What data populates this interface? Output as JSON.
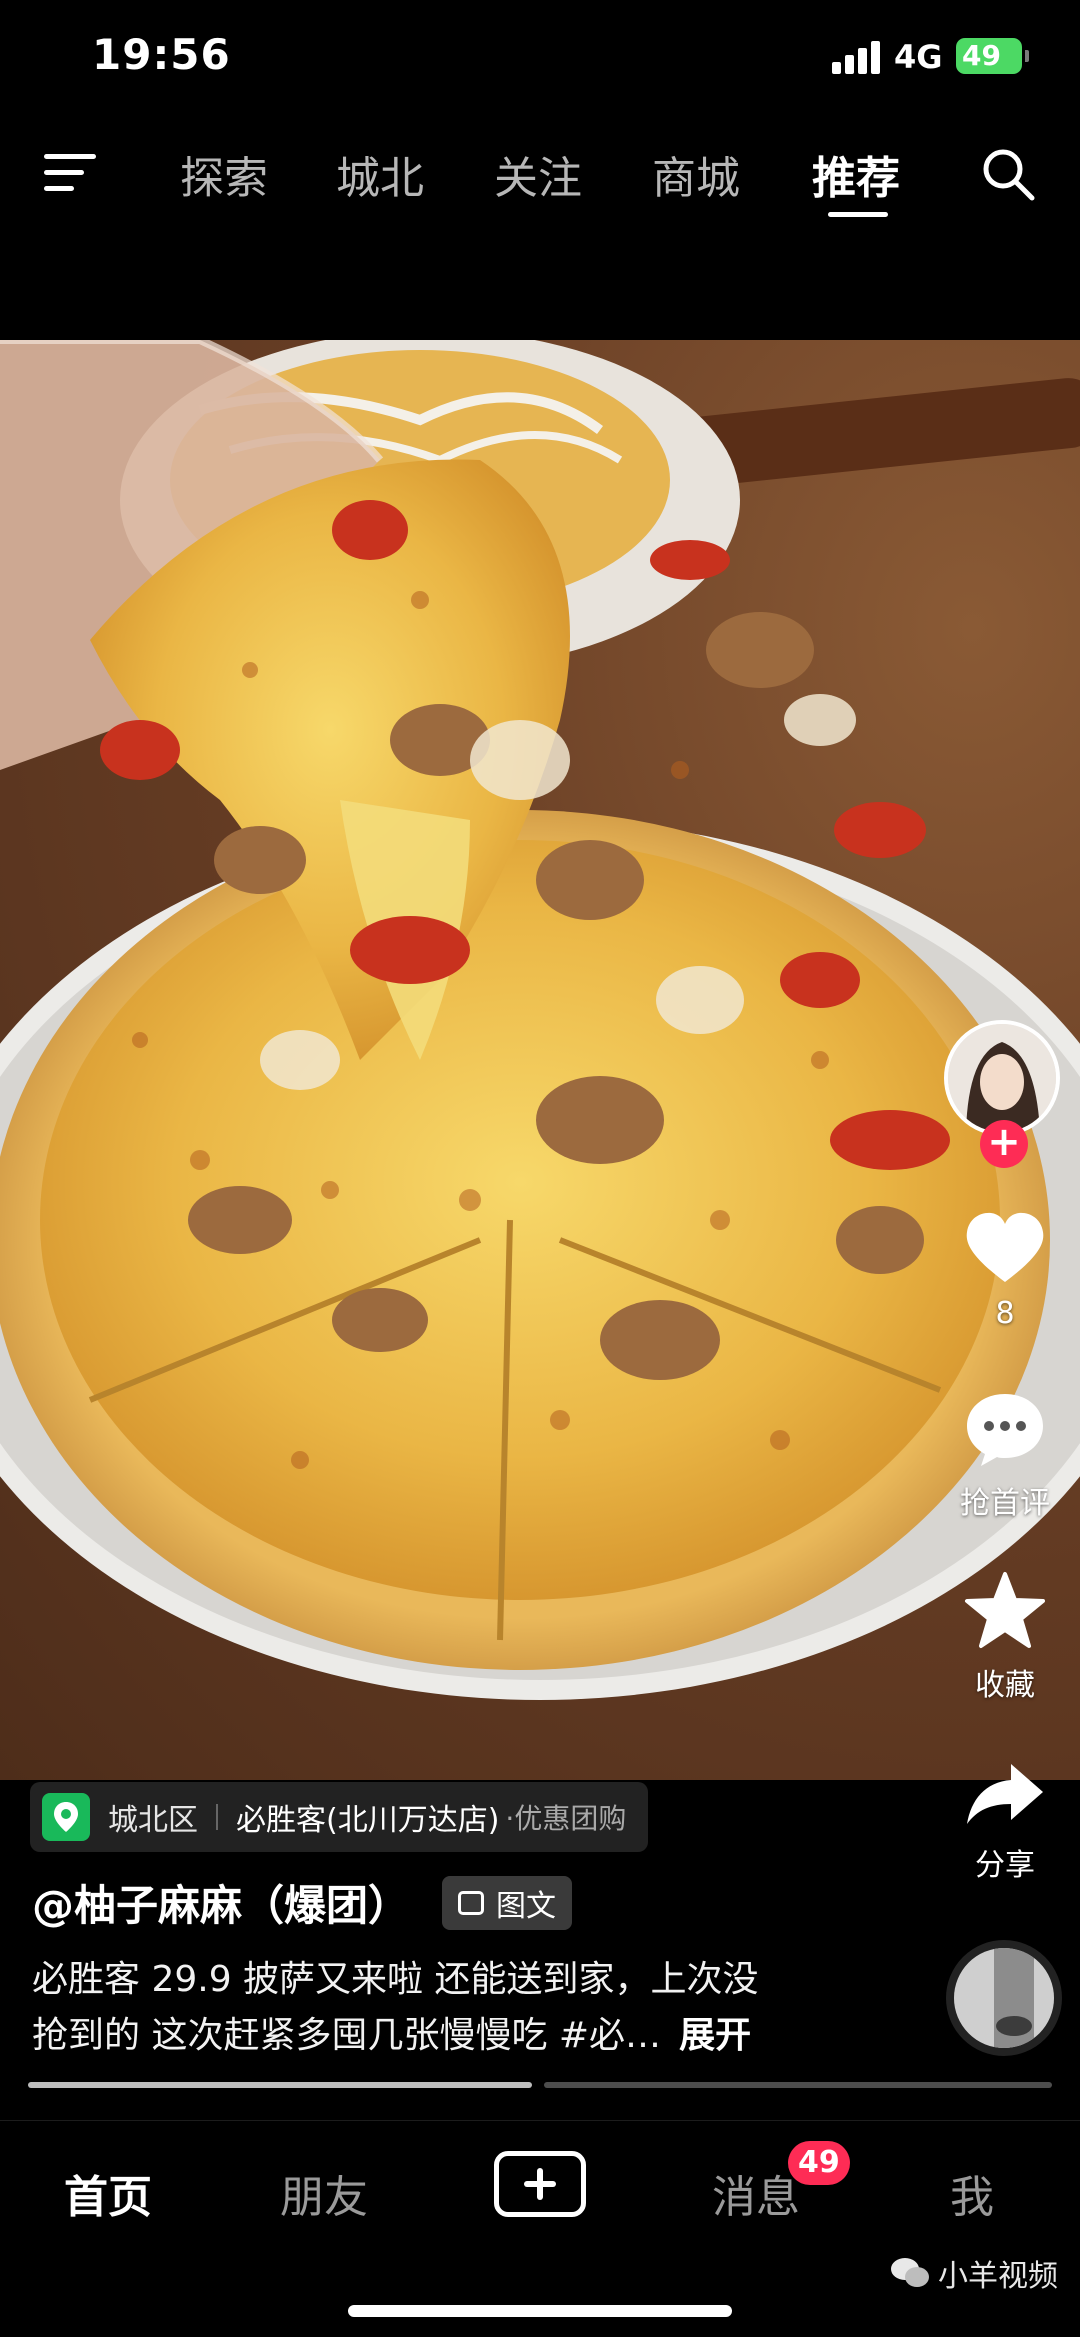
{
  "status_bar": {
    "time": "19:56",
    "network": "4G",
    "battery": "49"
  },
  "top_nav": {
    "tabs": [
      {
        "label": "探索",
        "active": false
      },
      {
        "label": "城北",
        "active": false
      },
      {
        "label": "关注",
        "active": false
      },
      {
        "label": "商城",
        "active": false
      },
      {
        "label": "推荐",
        "active": true
      }
    ]
  },
  "actions": {
    "follow_symbol": "+",
    "like_count": "8",
    "comment_label": "抢首评",
    "favorite_label": "收藏",
    "share_label": "分享"
  },
  "location": {
    "district": "城北区",
    "store": "必胜客(北川万达店)",
    "deal": "·优惠团购"
  },
  "post": {
    "author": "@柚子麻麻（爆团）",
    "type_badge": "图文",
    "caption_line1": "必胜客 29.9 披萨又来啦 还能送到家，上次没",
    "caption_line2": "抢到的 这次赶紧多囤几张慢慢吃 #必…",
    "expand_label": "展开",
    "image_progress": {
      "current": 1,
      "total": 2
    }
  },
  "bottom_tabs": {
    "home": "首页",
    "friends": "朋友",
    "messages": "消息",
    "messages_badge": "49",
    "me": "我"
  },
  "watermark": "小羊视频",
  "colors": {
    "accent": "#fe2c55",
    "location_pin": "#19b95a",
    "battery": "#4cd964"
  }
}
